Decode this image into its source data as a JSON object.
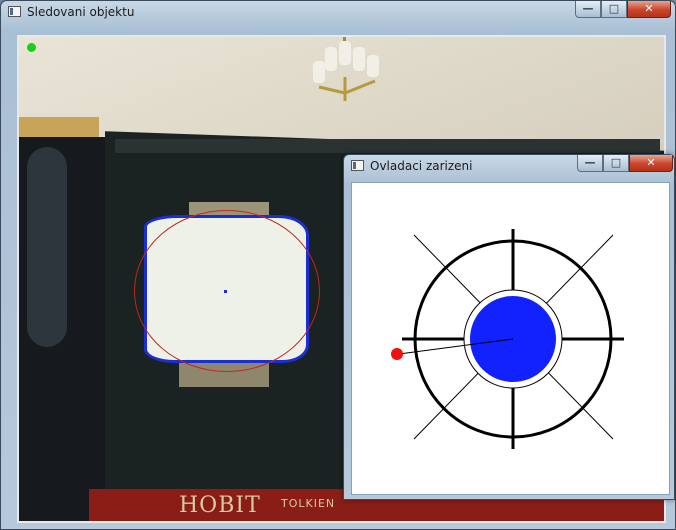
{
  "main_window": {
    "title": "Sledovani objektu",
    "controls": {
      "minimize": "—",
      "maximize": "□",
      "close": "✕"
    }
  },
  "camera_view": {
    "tracking_indicator_color": "#19d017",
    "contour_color": "#1b2ed6",
    "fit_circle_color": "#c0281c",
    "book_title": "HOBIT",
    "book_author": "TOLKIEN"
  },
  "control_window": {
    "title": "Ovladaci zarizeni",
    "controls": {
      "minimize": "—",
      "maximize": "□",
      "close": "✕"
    },
    "joystick": {
      "center_disc_color": "#1122ff",
      "pointer_color": "#ee1111",
      "spokes": 8
    }
  }
}
